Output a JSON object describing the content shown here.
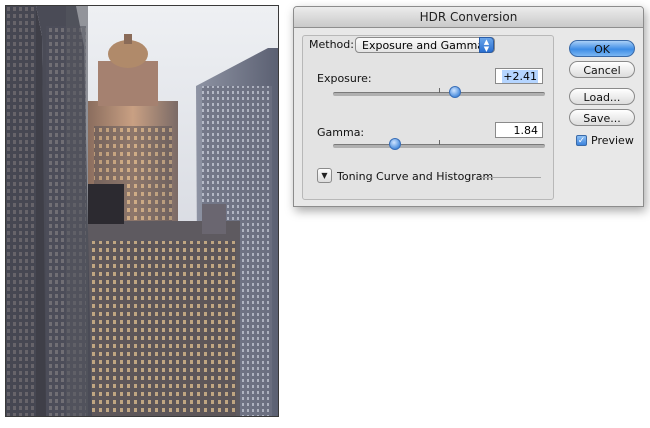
{
  "dialog": {
    "title": "HDR Conversion",
    "method_label": "Method:",
    "method_value": "Exposure and Gamma",
    "exposure_label": "Exposure:",
    "exposure_value": "+2.41",
    "exposure_slider_fraction": 0.57,
    "gamma_label": "Gamma:",
    "gamma_value": "1.84",
    "gamma_slider_fraction": 0.29,
    "toning_label": "Toning Curve and Histogram",
    "buttons": {
      "ok": "OK",
      "cancel": "Cancel",
      "load": "Load...",
      "save": "Save..."
    },
    "preview_label": "Preview",
    "preview_checked": true
  },
  "icons": {
    "popup": "popup-arrows-icon",
    "disclosure": "disclosure-triangle-icon",
    "check": "checkmark-icon"
  },
  "colors": {
    "accent": "#3e8de6",
    "dialog_bg": "#e8e8e8"
  }
}
